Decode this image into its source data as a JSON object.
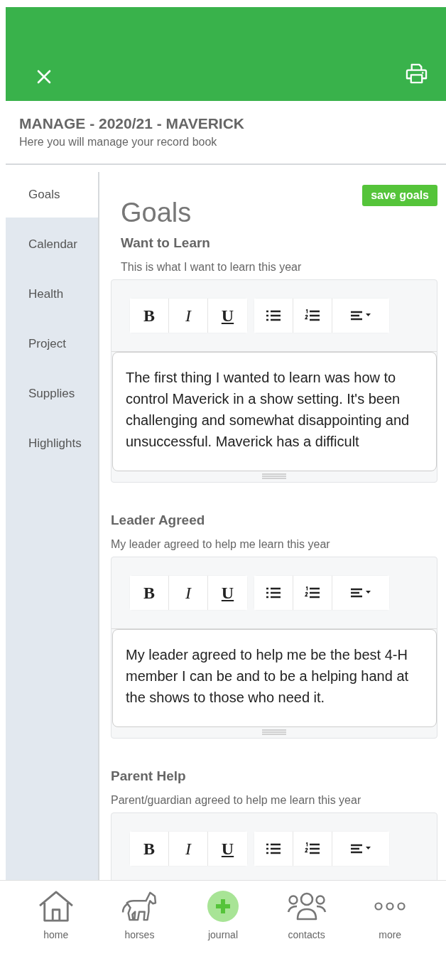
{
  "header": {
    "title": "MANAGE - 2020/21 - MAVERICK",
    "subtitle": "Here you will manage your record book"
  },
  "tabs": [
    {
      "label": "Goals",
      "selected": true
    },
    {
      "label": "Calendar",
      "selected": false
    },
    {
      "label": "Health",
      "selected": false
    },
    {
      "label": "Project",
      "selected": false
    },
    {
      "label": "Supplies",
      "selected": false
    },
    {
      "label": "Highlights",
      "selected": false
    }
  ],
  "page_title": "Goals",
  "save_button": "save goals",
  "sections": [
    {
      "heading": "Want to Learn",
      "hint": "This is what I want to learn this year",
      "toolbar": [
        "B",
        "I",
        "U"
      ],
      "value": "The first thing I wanted to learn was how to control Maverick in a show setting.  It's been challenging and somewhat disappointing and unsuccessful.  Maverick has a difficult"
    },
    {
      "heading": "Leader Agreed",
      "hint": "My leader agreed to help me learn this year",
      "toolbar": [
        "B",
        "I",
        "U"
      ],
      "value": "My leader agreed to help me be the best 4-H member I can be and to be a helping hand at the shows to those who need it."
    },
    {
      "heading": "Parent Help",
      "hint": "Parent/guardian agreed to help me learn this year",
      "toolbar": [
        "B",
        "I",
        "U"
      ]
    }
  ],
  "nav": [
    {
      "kind": "home",
      "label": "home"
    },
    {
      "kind": "horse",
      "label": "horses"
    },
    {
      "kind": "plus",
      "label": "journal"
    },
    {
      "kind": "people",
      "label": "contacts"
    },
    {
      "kind": "dots",
      "label": "more"
    }
  ]
}
